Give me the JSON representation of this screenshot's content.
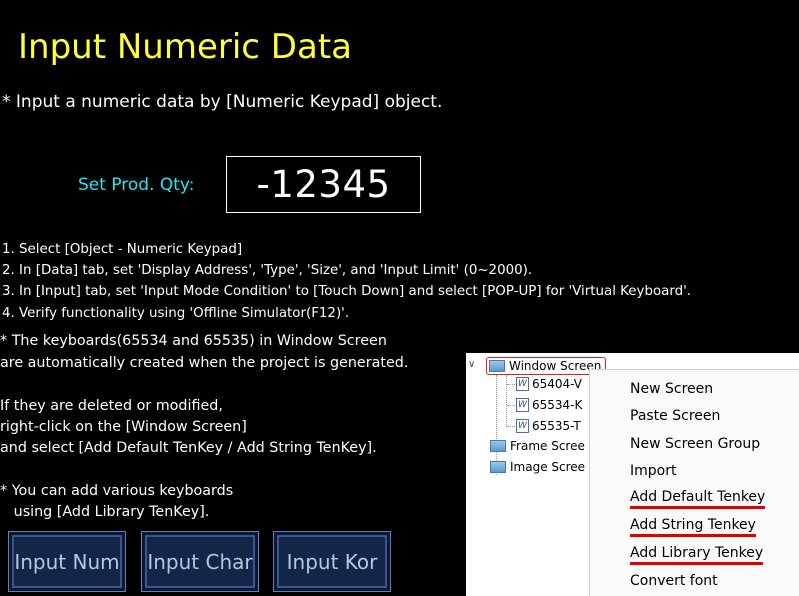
{
  "title": "Input Numeric Data",
  "subtitle": "*  Input a numeric data by [Numeric Keypad] object.",
  "qty": {
    "label": "Set Prod. Qty:",
    "value": "-12345"
  },
  "steps": [
    "1. Select [Object - Numeric Keypad]",
    "2. In [Data] tab, set 'Display Address', 'Type', 'Size', and 'Input Limit' (0~2000).",
    "3. In [Input] tab, set 'Input Mode Condition' to [Touch Down] and select [POP-UP] for 'Virtual Keyboard'.",
    "4. Verify functionality using 'Offline Simulator(F12)'."
  ],
  "note1": [
    "* The keyboards(65534 and 65535) in Window Screen",
    "are automatically created when the project is generated."
  ],
  "note2": [
    "If they are deleted or modified,",
    "right-click on the [Window Screen]",
    "and select [Add Default TenKey / Add String TenKey]."
  ],
  "note3": [
    "* You can add various keyboards",
    "   using [Add Library TenKey]."
  ],
  "buttons": {
    "input_num": "Input Num",
    "input_char": "Input Char",
    "input_kor": "Input Kor"
  },
  "tree": {
    "root": "Window Screen",
    "children": [
      "65404-V",
      "65534-K",
      "65535-T"
    ],
    "frame": "Frame Scree",
    "image": "Image Scree"
  },
  "context_menu": [
    "New Screen",
    "Paste Screen",
    "New Screen Group",
    "Import",
    "Add Default Tenkey",
    "Add String Tenkey",
    "Add Library Tenkey",
    "Convert font"
  ],
  "colors": {
    "title": "#ffff33",
    "label": "#22e5f5",
    "highlight": "#e00000",
    "button_bg": "#14254a"
  }
}
